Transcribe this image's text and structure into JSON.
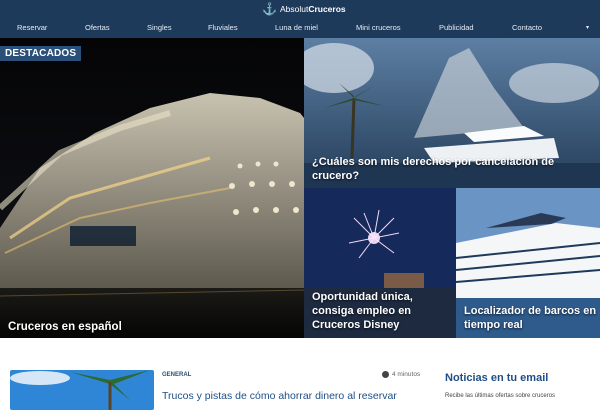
{
  "header": {
    "logo_prefix": "Absolut",
    "logo_bold": "Cruceros",
    "logo_icon": "anchor-icon",
    "bg_color": "#1e3a5a",
    "nav": [
      "Reservar",
      "Ofertas",
      "Singles",
      "Fluviales",
      "Luna de miel",
      "Mini cruceros",
      "Publicidad",
      "Contacto"
    ],
    "nav_more": "chevron-down-icon"
  },
  "hero": {
    "badge": "DESTACADOS",
    "main_title": "Cruceros en español",
    "top_right_title": "¿Cuáles son mis derechos por cancelación de crucero?",
    "mid_title": "Oportunidad única, consiga empleo en Cruceros Disney",
    "right_title": "Localizador de barcos en tiempo real"
  },
  "latest": {
    "category": "GENERAL",
    "read_time": "4 minutos",
    "post_title": "Trucos y pistas de cómo ahorrar dinero al reservar"
  },
  "newsletter": {
    "heading": "Noticias en tu email",
    "text": "Recibe las últimas ofertas sobre cruceros"
  }
}
